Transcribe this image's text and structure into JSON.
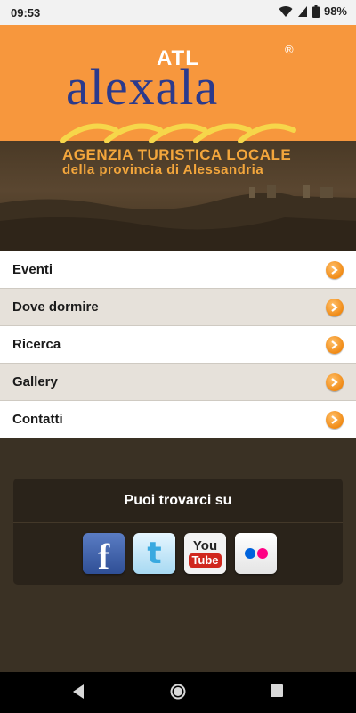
{
  "status": {
    "time": "09:53",
    "battery": "98%",
    "icons": [
      "wifi-icon",
      "signal-icon",
      "battery-icon"
    ]
  },
  "header": {
    "atl": "ATL",
    "brand": "alexala",
    "registered": "®",
    "tagline1": "AGENZIA TURISTICA LOCALE",
    "tagline2": "della provincia di Alessandria"
  },
  "menu": {
    "items": [
      {
        "label": "Eventi"
      },
      {
        "label": "Dove dormire"
      },
      {
        "label": "Ricerca"
      },
      {
        "label": "Gallery"
      },
      {
        "label": "Contatti"
      }
    ]
  },
  "social": {
    "title": "Puoi trovarci su",
    "icons": [
      {
        "name": "facebook-icon",
        "glyph": "f"
      },
      {
        "name": "twitter-icon",
        "glyph": "t"
      },
      {
        "name": "youtube-icon",
        "you": "You",
        "tube": "Tube"
      },
      {
        "name": "flickr-icon"
      }
    ]
  },
  "colors": {
    "header_orange": "#f7973d",
    "brand_blue": "#2b3a8c",
    "accent_orange": "#f08a15",
    "background": "#3a3124"
  }
}
